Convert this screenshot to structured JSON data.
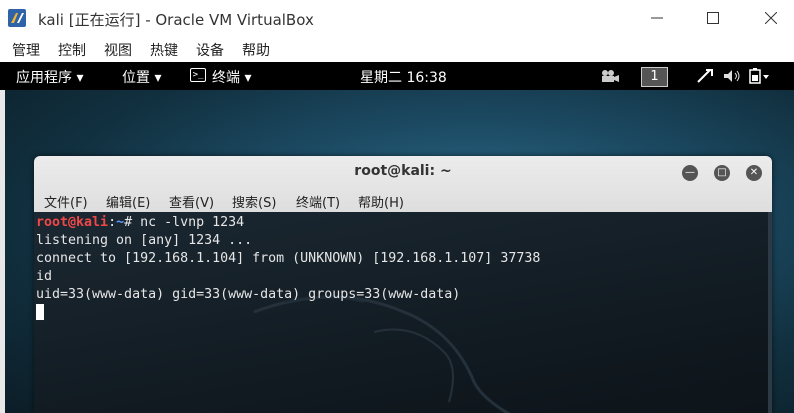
{
  "vbox": {
    "title": "kali [正在运行] - Oracle VM VirtualBox",
    "menu": [
      "管理",
      "控制",
      "视图",
      "热键",
      "设备",
      "帮助"
    ]
  },
  "gnome_bar": {
    "apps": "应用程序",
    "places": "位置",
    "terminal": "终端",
    "clock": "星期二 16:38",
    "workspace": "1"
  },
  "terminal": {
    "title": "root@kali: ~",
    "menu": [
      "文件(F)",
      "编辑(E)",
      "查看(V)",
      "搜索(S)",
      "终端(T)",
      "帮助(H)"
    ],
    "prompt_user": "root@kali",
    "prompt_colon": ":",
    "prompt_path": "~",
    "prompt_symbol": "# ",
    "command": "nc -lvnp 1234",
    "output": [
      "listening on [any] 1234 ...",
      "connect to [192.168.1.104] from (UNKNOWN) [192.168.1.107] 37738",
      "id",
      "uid=33(www-data) gid=33(www-data) groups=33(www-data)"
    ]
  },
  "colors": {
    "prompt_user": "#f04848",
    "prompt_path": "#5f9bff",
    "gnome_bar": "#000000"
  }
}
